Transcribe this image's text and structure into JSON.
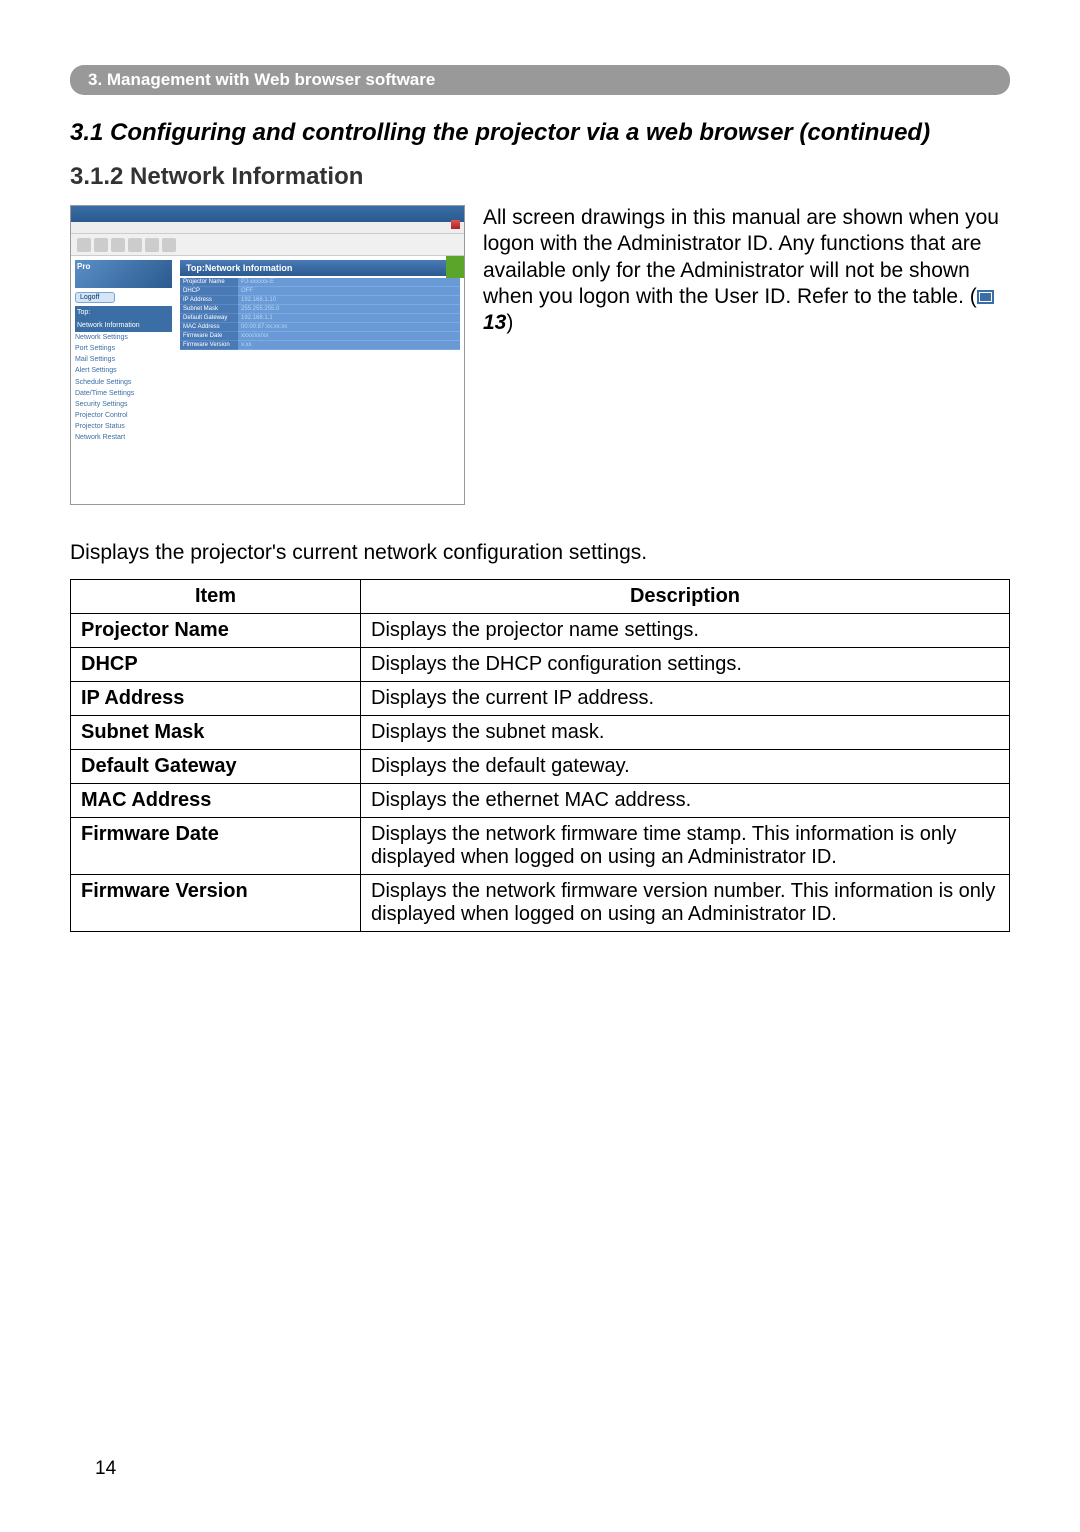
{
  "header": "3. Management with Web browser software",
  "section_title": "3.1 Configuring and controlling the projector via a web browser (continued)",
  "subsection_title": "3.1.2 Network Information",
  "screenshot": {
    "logo_text": "Pro",
    "logoff_btn": "Logoff",
    "main_title": "Top:Network Information",
    "sidebar": [
      "Top:",
      "Network Information",
      "Network Settings",
      "Port Settings",
      "Mail Settings",
      "Alert Settings",
      "Schedule Settings",
      "Date/Time Settings",
      "Security Settings",
      "Projector Control",
      "Projector Status",
      "Network Restart"
    ],
    "info_rows": [
      {
        "label": "Projector Name",
        "value": "PJ-xxxxxx-E"
      },
      {
        "label": "DHCP",
        "value": "OFF"
      },
      {
        "label": "IP Address",
        "value": "192.168.1.10"
      },
      {
        "label": "Subnet Mask",
        "value": "255.255.255.0"
      },
      {
        "label": "Default Gateway",
        "value": "192.168.1.1"
      },
      {
        "label": "MAC Address",
        "value": "00:00:87:xx:xx:xx"
      },
      {
        "label": "Firmware Date",
        "value": "xxxx/xx/xx"
      },
      {
        "label": "Firmware Version",
        "value": "x.xx"
      }
    ]
  },
  "paragraph": {
    "line1": "All screen drawings in this manual are shown when you logon with the Administrator ID.",
    "line2": "Any functions that are available only for the Administrator will not be shown when you logon with the User ID. Refer to the table. (",
    "ref_num": "13",
    "line3": ")"
  },
  "desc_text": "Displays the projector's current network configuration settings.",
  "table": {
    "headers": [
      "Item",
      "Description"
    ],
    "rows": [
      {
        "item": "Projector Name",
        "desc": "Displays the projector name settings."
      },
      {
        "item": "DHCP",
        "desc": "Displays the DHCP configuration settings."
      },
      {
        "item": "IP Address",
        "desc": "Displays the current IP address."
      },
      {
        "item": "Subnet Mask",
        "desc": "Displays the subnet mask."
      },
      {
        "item": "Default Gateway",
        "desc": "Displays the default gateway."
      },
      {
        "item": "MAC Address",
        "desc": "Displays the ethernet MAC address."
      },
      {
        "item": "Firmware Date",
        "desc": "Displays the network firmware time stamp. This information is only displayed when logged on using an Administrator ID."
      },
      {
        "item": "Firmware Version",
        "desc": "Displays the network firmware version number. This information is only displayed when logged on using an Administrator ID."
      }
    ]
  },
  "page_number": "14"
}
